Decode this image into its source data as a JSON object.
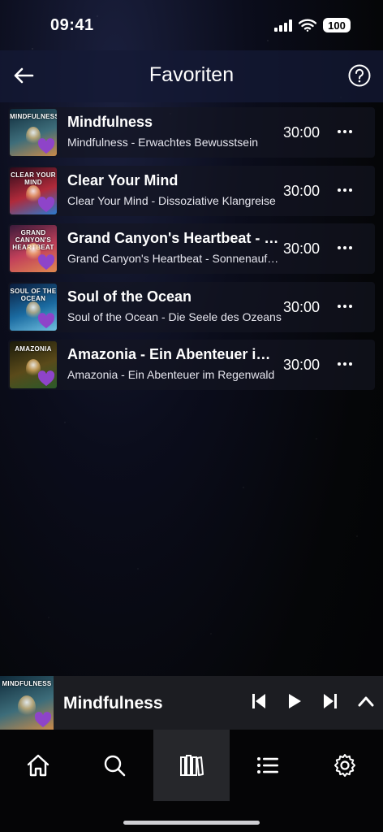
{
  "status_bar": {
    "time": "09:41",
    "battery": "100"
  },
  "header": {
    "title": "Favoriten"
  },
  "favorites": [
    {
      "cover_label": "MINDFULNESS",
      "title": "Mindfulness",
      "subtitle": "Mindfulness - Erwachtes Bewusstsein",
      "duration": "30:00",
      "cover_colors": [
        "#0f2a3a",
        "#3d6d7a",
        "#c98a4a"
      ]
    },
    {
      "cover_label": "CLEAR YOUR MIND",
      "title": "Clear Your Mind",
      "subtitle": "Clear Your Mind - Dissoziative Klangreise",
      "duration": "30:00",
      "cover_colors": [
        "#2a0a1a",
        "#b02a3a",
        "#2a7ad0"
      ]
    },
    {
      "cover_label": "GRAND CANYON'S HEARTBEAT",
      "title": "Grand Canyon's Heartbeat - Sonnenaufgang",
      "subtitle": "Grand Canyon's Heartbeat - Sonnenaufgang",
      "duration": "30:00",
      "cover_colors": [
        "#3a1a3a",
        "#c2405a",
        "#e08a50"
      ]
    },
    {
      "cover_label": "SOUL OF THE OCEAN",
      "title": "Soul of the Ocean",
      "subtitle": "Soul of the Ocean - Die Seele des Ozeans",
      "duration": "30:00",
      "cover_colors": [
        "#0a1a3a",
        "#1a6aa0",
        "#70c0e0"
      ]
    },
    {
      "cover_label": "AMAZONIA",
      "title": "Amazonia - Ein Abenteuer im Regenwald",
      "subtitle": "Amazonia - Ein Abenteuer im Regenwald",
      "duration": "30:00",
      "cover_colors": [
        "#1a1a0a",
        "#5a4a1a",
        "#2a5a2a"
      ]
    }
  ],
  "mini_player": {
    "title": "Mindfulness",
    "cover_label": "MINDFULNESS"
  },
  "tabs": [
    "home",
    "search",
    "library",
    "playlists",
    "settings"
  ],
  "colors": {
    "accent_heart": "#8e44c9",
    "header_bg": "#141a36",
    "active_tab_bg": "#26272b"
  }
}
